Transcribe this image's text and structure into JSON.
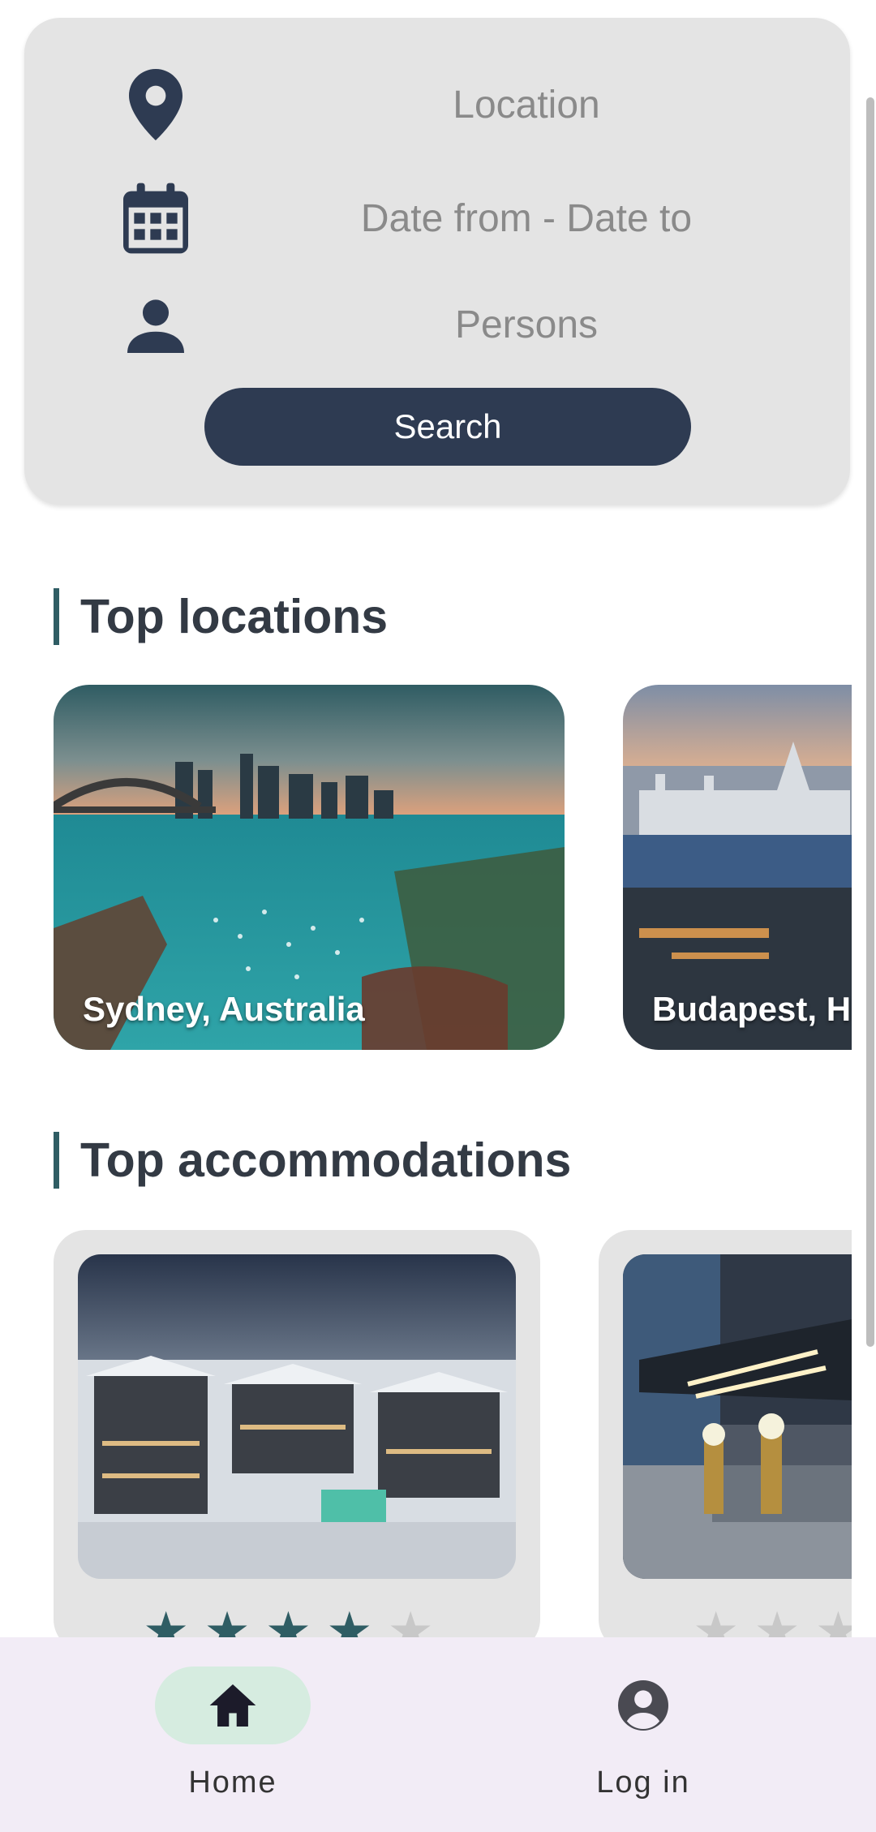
{
  "search": {
    "location_placeholder": "Location",
    "dates_placeholder": "Date from - Date to",
    "persons_placeholder": "Persons",
    "button_label": "Search"
  },
  "sections": {
    "top_locations_title": "Top locations",
    "top_accommodations_title": "Top accommodations"
  },
  "locations": [
    {
      "name": "Sydney, Australia"
    },
    {
      "name": "Budapest, H"
    }
  ],
  "accommodations": [
    {
      "rating": 4,
      "max_rating": 5
    },
    {
      "rating": 0,
      "max_rating": 5
    }
  ],
  "nav": {
    "home_label": "Home",
    "login_label": "Log in",
    "active": "home"
  },
  "colors": {
    "primary": "#2e3b52",
    "accent": "#2f5d64",
    "star_filled": "#2f5d64",
    "star_empty": "#c8c8c8",
    "nav_active_pill": "#d6ece0"
  }
}
